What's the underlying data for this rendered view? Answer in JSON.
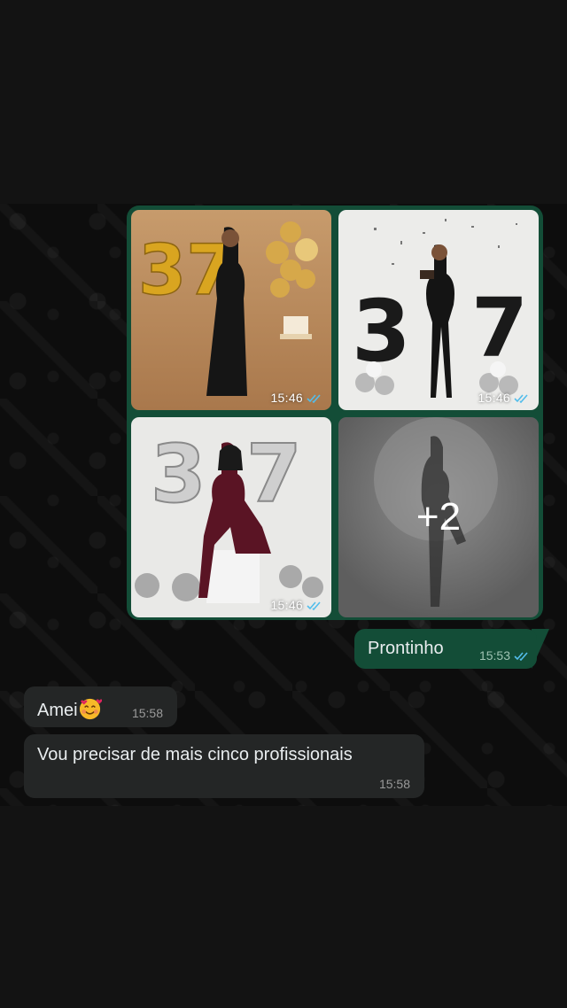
{
  "album": {
    "photos": [
      {
        "time": "15:46"
      },
      {
        "time": "15:46"
      },
      {
        "time": "15:46"
      },
      {
        "more_label": "+2"
      }
    ]
  },
  "messages": [
    {
      "direction": "outgoing",
      "text": "Prontinho",
      "time": "15:53",
      "status": "read"
    },
    {
      "direction": "incoming",
      "text": "Amei",
      "emoji": "smiling-face-with-hearts",
      "time": "15:58"
    },
    {
      "direction": "incoming",
      "text": "Vou precisar de mais cinco profissionais",
      "time": "15:58"
    }
  ],
  "colors": {
    "outgoing_bubble": "#134d37",
    "incoming_bubble": "#242626",
    "read_ticks": "#53bdeb"
  }
}
